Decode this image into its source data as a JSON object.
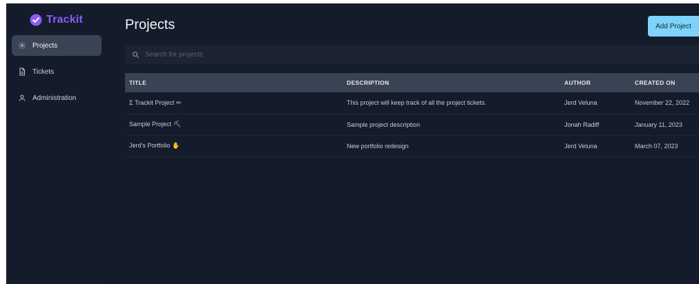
{
  "app": {
    "name": "Trackit",
    "accent_color": "#8b5cf6"
  },
  "sidebar": {
    "items": [
      {
        "label": "Projects",
        "icon": "gear-icon",
        "active": true
      },
      {
        "label": "Tickets",
        "icon": "document-icon",
        "active": false
      },
      {
        "label": "Administration",
        "icon": "user-icon",
        "active": false
      }
    ]
  },
  "main": {
    "title": "Projects",
    "add_button_label": "Add Project",
    "add_button_color": "#7dd3fc",
    "search": {
      "placeholder": "Search for projects",
      "value": ""
    },
    "table": {
      "columns": [
        "TITLE",
        "DESCRIPTION",
        "AUTHOR",
        "CREATED ON"
      ],
      "rows": [
        {
          "title": "Trackit Project",
          "title_prefix": "Σ",
          "emoji": "✏",
          "description": "This project will keep track of all the project tickets.",
          "author": "Jerd Veluna",
          "created_on": "November 22, 2022"
        },
        {
          "title": "Sample Project",
          "title_prefix": "",
          "emoji": "⛏",
          "description": "Sample project description",
          "author": "Jonah Radiff",
          "created_on": "January 11, 2023"
        },
        {
          "title": "Jerd's Portfolio",
          "title_prefix": "",
          "emoji": "✋",
          "description": "New portfolio redesign",
          "author": "Jerd Veluna",
          "created_on": "March 07, 2023"
        }
      ]
    }
  }
}
